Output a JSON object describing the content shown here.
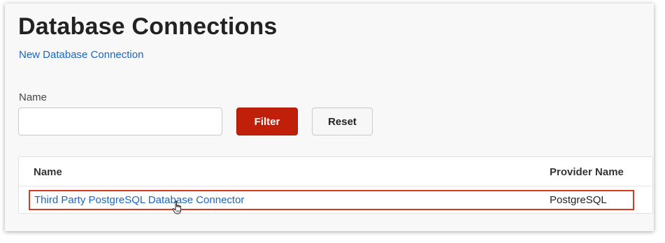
{
  "page": {
    "title": "Database Connections",
    "new_link": "New Database Connection"
  },
  "filter": {
    "name_label": "Name",
    "name_value": "",
    "name_placeholder": "",
    "filter_button": "Filter",
    "reset_button": "Reset"
  },
  "table": {
    "columns": [
      "Name",
      "Provider Name"
    ],
    "rows": [
      {
        "name": "Third Party PostgreSQL Database Connector",
        "provider": "PostgreSQL"
      }
    ]
  },
  "colors": {
    "accent": "#c0200a",
    "link": "#1a64c4",
    "highlight_border": "#d93a1f"
  },
  "icons": {
    "cursor": "hand-pointer-icon"
  }
}
